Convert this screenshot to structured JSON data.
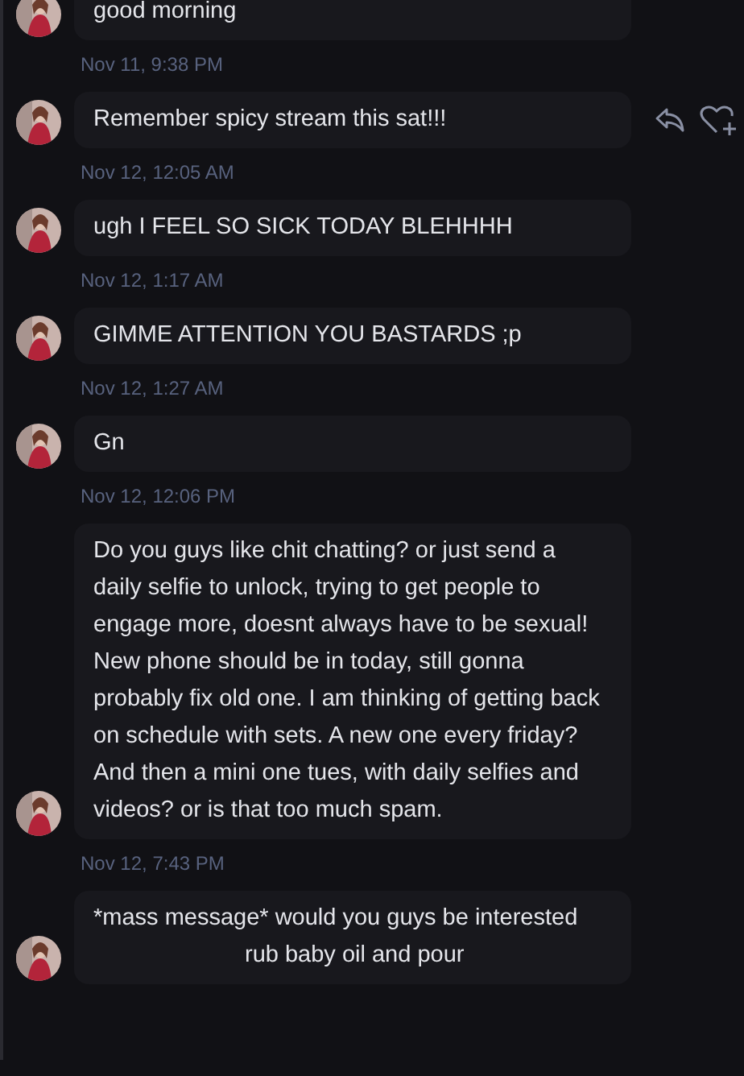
{
  "messages": [
    {
      "text": "good morning",
      "time": "Nov 11, 9:38 PM"
    },
    {
      "text": "Remember spicy stream this sat!!!",
      "time": "Nov 12, 12:05 AM",
      "show_actions": true
    },
    {
      "text": "ugh I FEEL SO SICK TODAY BLEHHHH",
      "time": "Nov 12, 1:17 AM"
    },
    {
      "text": "GIMME ATTENTION YOU BASTARDS ;p",
      "time": "Nov 12, 1:27 AM"
    },
    {
      "text": "Gn",
      "time": "Nov 12, 12:06 PM"
    },
    {
      "text": "Do you guys like chit chatting? or just send a daily selfie to unlock, trying to get people to engage more, doesnt always have to be sexual! New phone should be in today, still gonna probably fix old one. I am thinking of getting back on schedule with sets.  A new one every friday? And then a mini one tues, with daily selfies and videos? or is that too much spam.",
      "time": "Nov 12, 7:43 PM"
    },
    {
      "text": "*mass message* would you guys be interested",
      "partial_line": "rub baby oil and pour"
    }
  ]
}
